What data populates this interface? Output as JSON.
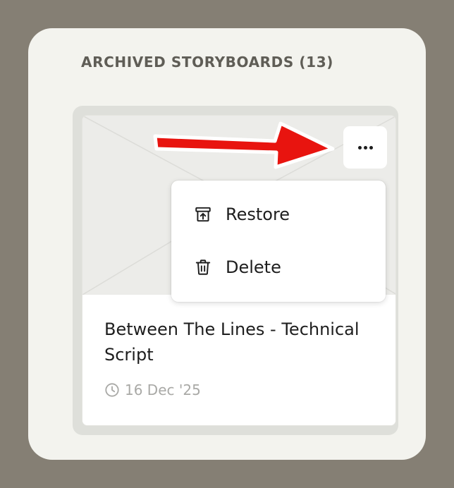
{
  "section": {
    "title": "ARCHIVED STORYBOARDS (13)"
  },
  "card": {
    "title": "Between The Lines - Technical Script",
    "date": "16 Dec '25",
    "date_icon": "clock-icon",
    "more_icon": "more-horizontal-icon"
  },
  "menu": {
    "items": [
      {
        "label": "Restore",
        "icon": "archive-restore-icon"
      },
      {
        "label": "Delete",
        "icon": "trash-icon"
      }
    ]
  },
  "annotation": {
    "arrow_color": "#e8140f",
    "arrow_outline": "#ffffff"
  },
  "colors": {
    "backdrop": "#857f74",
    "panel": "#f3f3ee",
    "card_frame": "#dedfda",
    "thumbnail": "#ececE9",
    "title_text": "#5f5d56",
    "date_text": "#a9a9a6"
  }
}
